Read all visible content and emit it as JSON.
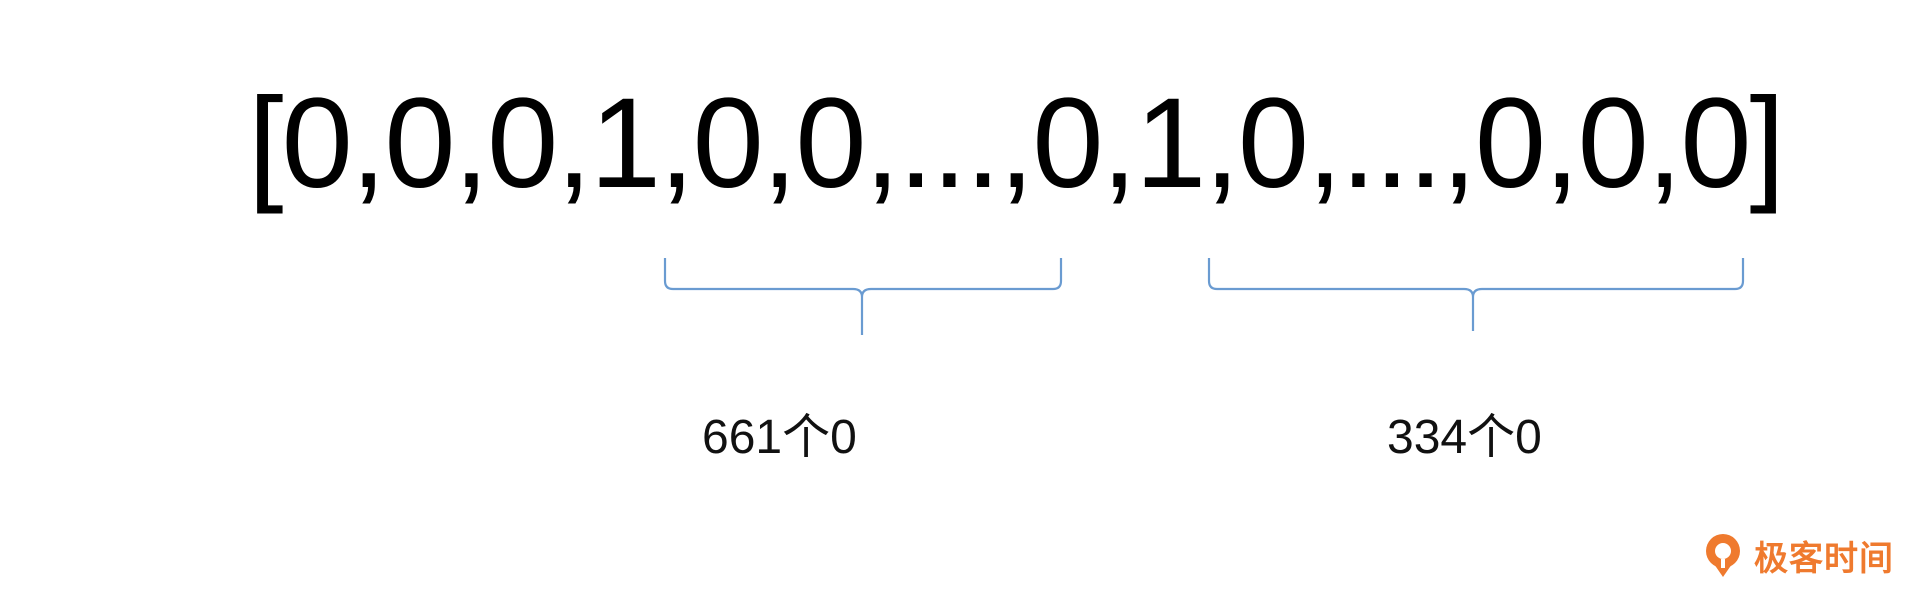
{
  "diagram": {
    "vector_text": "[0,0,0,1,0,0,...,0,1,0,...,0,0,0]",
    "brace_color": "#6a9bd1",
    "braces": [
      {
        "label": "661个0"
      },
      {
        "label": "334个0"
      }
    ]
  },
  "brand": {
    "icon": "geektime-logo-icon",
    "name": "极客时间",
    "color": "#ef7a2e"
  }
}
